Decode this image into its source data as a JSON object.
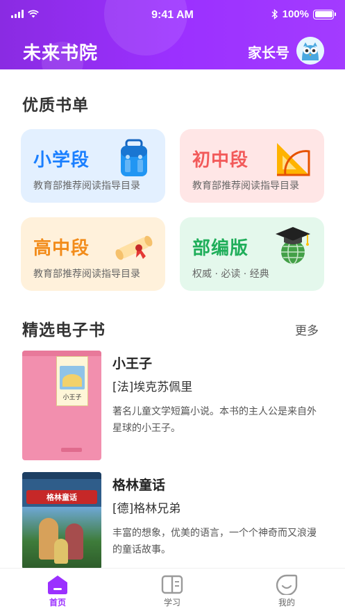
{
  "status_bar": {
    "time": "9:41 AM",
    "battery": "100%",
    "battery_level": 1.0
  },
  "header": {
    "app_title": "未来书院",
    "parent_link": "家长号"
  },
  "sections": {
    "quality_lists": "优质书单",
    "ebooks": "精选电子书",
    "more": "更多"
  },
  "cards": [
    {
      "title": "小学段",
      "subtitle": "教育部推荐阅读指导目录",
      "icon": "school-backpack-icon",
      "bg": "#e3f0ff",
      "color": "#1a7fff"
    },
    {
      "title": "初中段",
      "subtitle": "教育部推荐阅读指导目录",
      "icon": "ruler-triangle-icon",
      "bg": "#ffe6e6",
      "color": "#f25a5a"
    },
    {
      "title": "高中段",
      "subtitle": "教育部推荐阅读指导目录",
      "icon": "diploma-scroll-icon",
      "bg": "#fff1db",
      "color": "#f28c1b"
    },
    {
      "title": "部编版",
      "subtitle": "权威 · 必读 · 经典",
      "icon": "graduation-globe-icon",
      "bg": "#e4f8ec",
      "color": "#1fae5a"
    }
  ],
  "books": [
    {
      "title": "小王子",
      "author": "[法]埃克苏佩里",
      "description": "著名儿童文学短篇小说。本书的主人公是来自外星球的小王子。",
      "cover_title": "小王子"
    },
    {
      "title": "格林童话",
      "author": "[德]格林兄弟",
      "description": "丰富的想象，优美的语言，一个个神奇而又浪漫的童话故事。",
      "cover_title": "格林童话"
    }
  ],
  "tabs": [
    {
      "label": "首页",
      "active": true
    },
    {
      "label": "学习",
      "active": false
    },
    {
      "label": "我的",
      "active": false
    }
  ],
  "colors": {
    "accent": "#9b30ff",
    "header_start": "#8a2be2",
    "header_end": "#a33bff"
  }
}
